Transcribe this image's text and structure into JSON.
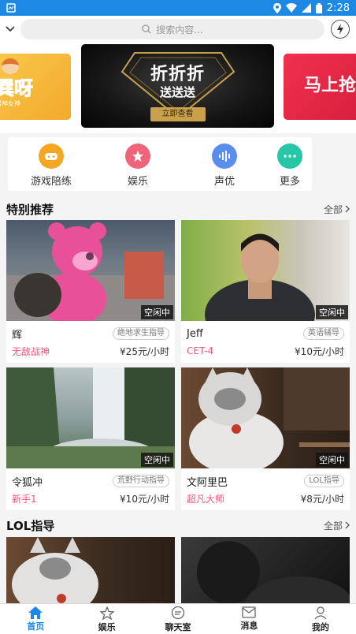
{
  "status_bar": {
    "time": "2:28"
  },
  "search": {
    "placeholder": "搜索内容..."
  },
  "banners": {
    "left": {
      "text": "巽呀",
      "sub": "男神女神"
    },
    "center": {
      "title": "折折折",
      "subtitle": "送送送",
      "button": "立即查看"
    },
    "right": {
      "text": "马上抢"
    }
  },
  "categories": [
    {
      "label": "游戏陪练",
      "color": "#f5a623",
      "icon": "gamepad-icon"
    },
    {
      "label": "娱乐",
      "color": "#f0647a",
      "icon": "star-icon"
    },
    {
      "label": "声优",
      "color": "#5b8def",
      "icon": "voice-icon"
    },
    {
      "label": "更多",
      "color": "#26c6a6",
      "icon": "more-icon"
    }
  ],
  "sections": {
    "special": {
      "title": "特别推荐",
      "more": "全部"
    },
    "lol": {
      "title": "LOL指导",
      "more": "全部"
    }
  },
  "cards": [
    {
      "name": "辉",
      "tag": "绝地求生指导",
      "rank": "无敌战神",
      "price": "¥25元/小时",
      "status": "空闲中"
    },
    {
      "name": "Jeff",
      "tag": "英语辅导",
      "rank": "CET-4",
      "price": "¥10元/小时",
      "status": "空闲中"
    },
    {
      "name": "令狐冲",
      "tag": "荒野行动指导",
      "rank": "新手1",
      "price": "¥10元/小时",
      "status": "空闲中"
    },
    {
      "name": "文阿里巴",
      "tag": "LOL指导",
      "rank": "超凡大师",
      "price": "¥8元/小时",
      "status": "空闲中"
    }
  ],
  "bottom_nav": [
    {
      "label": "首页",
      "icon": "home-icon",
      "active": true
    },
    {
      "label": "娱乐",
      "icon": "star-icon",
      "active": false
    },
    {
      "label": "聊天室",
      "icon": "chat-icon",
      "active": false
    },
    {
      "label": "消息",
      "icon": "mail-icon",
      "active": false
    },
    {
      "label": "我的",
      "icon": "user-icon",
      "active": false
    }
  ],
  "colors": {
    "primary": "#1e88e5",
    "rank_pink": "#f05a7b"
  }
}
